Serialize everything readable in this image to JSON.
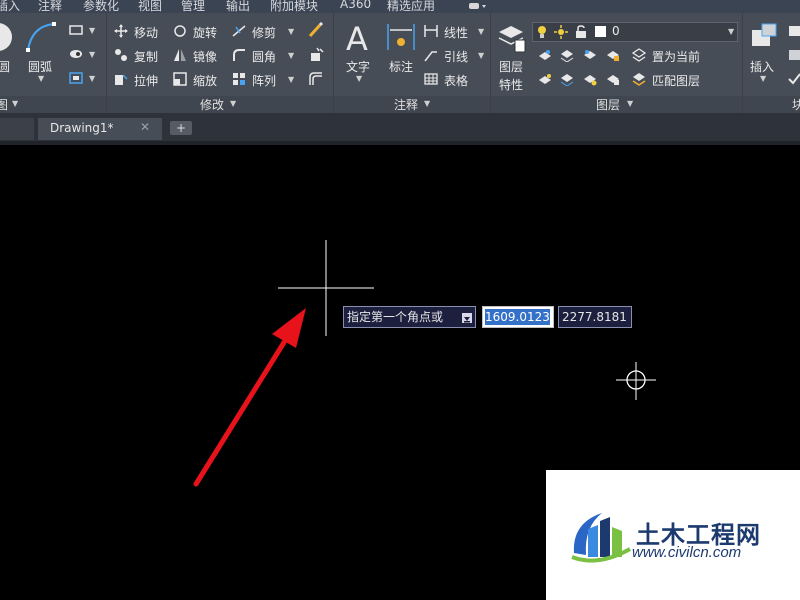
{
  "menu_tabs": [
    "插入",
    "注释",
    "参数化",
    "视图",
    "管理",
    "输出",
    "附加模块",
    "A360",
    "精选应用"
  ],
  "ribbon": {
    "draw": {
      "arc_label": "圆弧",
      "circle_label": "圆",
      "panel_title": "图"
    },
    "modify": {
      "panel_title": "修改",
      "tools": [
        {
          "label": "移动"
        },
        {
          "label": "旋转"
        },
        {
          "label": "修剪"
        },
        {
          "label": "复制"
        },
        {
          "label": "镜像"
        },
        {
          "label": "圆角"
        },
        {
          "label": "拉伸"
        },
        {
          "label": "缩放"
        },
        {
          "label": "阵列"
        }
      ]
    },
    "annotation": {
      "panel_title": "注释",
      "text_label": "文字",
      "dim_label": "标注",
      "linear_label": "线性",
      "leader_label": "引线",
      "table_label": "表格"
    },
    "layers": {
      "panel_title": "图层",
      "props_label_1": "图层",
      "props_label_2": "特性",
      "current_layer": "0",
      "set_current_label": "置为当前",
      "match_label": "匹配图层"
    },
    "block": {
      "insert_label": "插入",
      "panel_title_partial": "块"
    }
  },
  "document_tab": {
    "label": "Drawing1*"
  },
  "dynamic_input": {
    "prompt": "指定第一个角点或",
    "x_value": "1609.0123",
    "y_value": "2277.8181"
  },
  "watermark": {
    "name": "土木工程网",
    "url": "www.civilcn.com"
  },
  "colors": {
    "arrow": "#e8121a",
    "canvas": "#000000",
    "ribbon": "#474d57",
    "highlight": "#3471c9"
  }
}
